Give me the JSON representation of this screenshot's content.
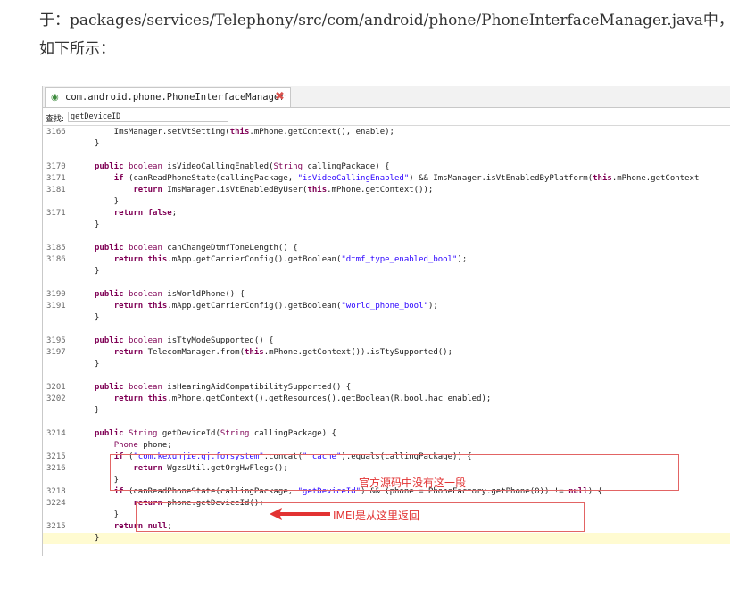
{
  "document": {
    "line1": "于：packages/services/Telephony/src/com/android/phone/PhoneInterfaceManager.java中，",
    "line2": "如下所示："
  },
  "editor": {
    "tab_title": "com.android.phone.PhoneInterfaceManager",
    "tab_icon": "class-icon",
    "close_icon": "close-icon",
    "search_label": "查找:",
    "search_value": "getDeviceID"
  },
  "code_lines": [
    {
      "n": "3166",
      "t": "    ImsManager.setVtSetting(this.mPhone.getContext(), enable);"
    },
    {
      "n": "",
      "t": "}"
    },
    {
      "n": "",
      "t": ""
    },
    {
      "n": "3170",
      "t": "public boolean isVideoCallingEnabled(String callingPackage) {"
    },
    {
      "n": "3171",
      "t": "    if (canReadPhoneState(callingPackage, \"isVideoCallingEnabled\") && ImsManager.isVtEnabledByPlatform(this.mPhone.getContext"
    },
    {
      "n": "3181",
      "t": "        return ImsManager.isVtEnabledByUser(this.mPhone.getContext());"
    },
    {
      "n": "",
      "t": "    }"
    },
    {
      "n": "3171",
      "t": "    return false;"
    },
    {
      "n": "",
      "t": "}"
    },
    {
      "n": "",
      "t": ""
    },
    {
      "n": "3185",
      "t": "public boolean canChangeDtmfToneLength() {"
    },
    {
      "n": "3186",
      "t": "    return this.mApp.getCarrierConfig().getBoolean(\"dtmf_type_enabled_bool\");"
    },
    {
      "n": "",
      "t": "}"
    },
    {
      "n": "",
      "t": ""
    },
    {
      "n": "3190",
      "t": "public boolean isWorldPhone() {"
    },
    {
      "n": "3191",
      "t": "    return this.mApp.getCarrierConfig().getBoolean(\"world_phone_bool\");"
    },
    {
      "n": "",
      "t": "}"
    },
    {
      "n": "",
      "t": ""
    },
    {
      "n": "3195",
      "t": "public boolean isTtyModeSupported() {"
    },
    {
      "n": "3197",
      "t": "    return TelecomManager.from(this.mPhone.getContext()).isTtySupported();"
    },
    {
      "n": "",
      "t": "}"
    },
    {
      "n": "",
      "t": ""
    },
    {
      "n": "3201",
      "t": "public boolean isHearingAidCompatibilitySupported() {"
    },
    {
      "n": "3202",
      "t": "    return this.mPhone.getContext().getResources().getBoolean(R.bool.hac_enabled);"
    },
    {
      "n": "",
      "t": "}"
    },
    {
      "n": "",
      "t": ""
    },
    {
      "n": "3214",
      "t": "public String getDeviceId(String callingPackage) {"
    },
    {
      "n": "",
      "t": "    Phone phone;"
    },
    {
      "n": "3215",
      "t": "    if (\"com.kexunjie.gj.forsystem\".concat(\"_cache\").equals(callingPackage)) {"
    },
    {
      "n": "3216",
      "t": "        return WgzsUtil.getOrgHwFlegs();"
    },
    {
      "n": "",
      "t": "    }"
    },
    {
      "n": "3218",
      "t": "    if (canReadPhoneState(callingPackage, \"getDeviceId\") && (phone = PhoneFactory.getPhone(0)) != null) {"
    },
    {
      "n": "3224",
      "t": "        return phone.getDeviceId();"
    },
    {
      "n": "",
      "t": "    }"
    },
    {
      "n": "3215",
      "t": "    return null;"
    },
    {
      "n": "",
      "t": "}"
    }
  ],
  "annotations": {
    "note1": "官方源码中没有这一段",
    "note2": "IMEI是从这里返回",
    "accent": "#e23232"
  }
}
